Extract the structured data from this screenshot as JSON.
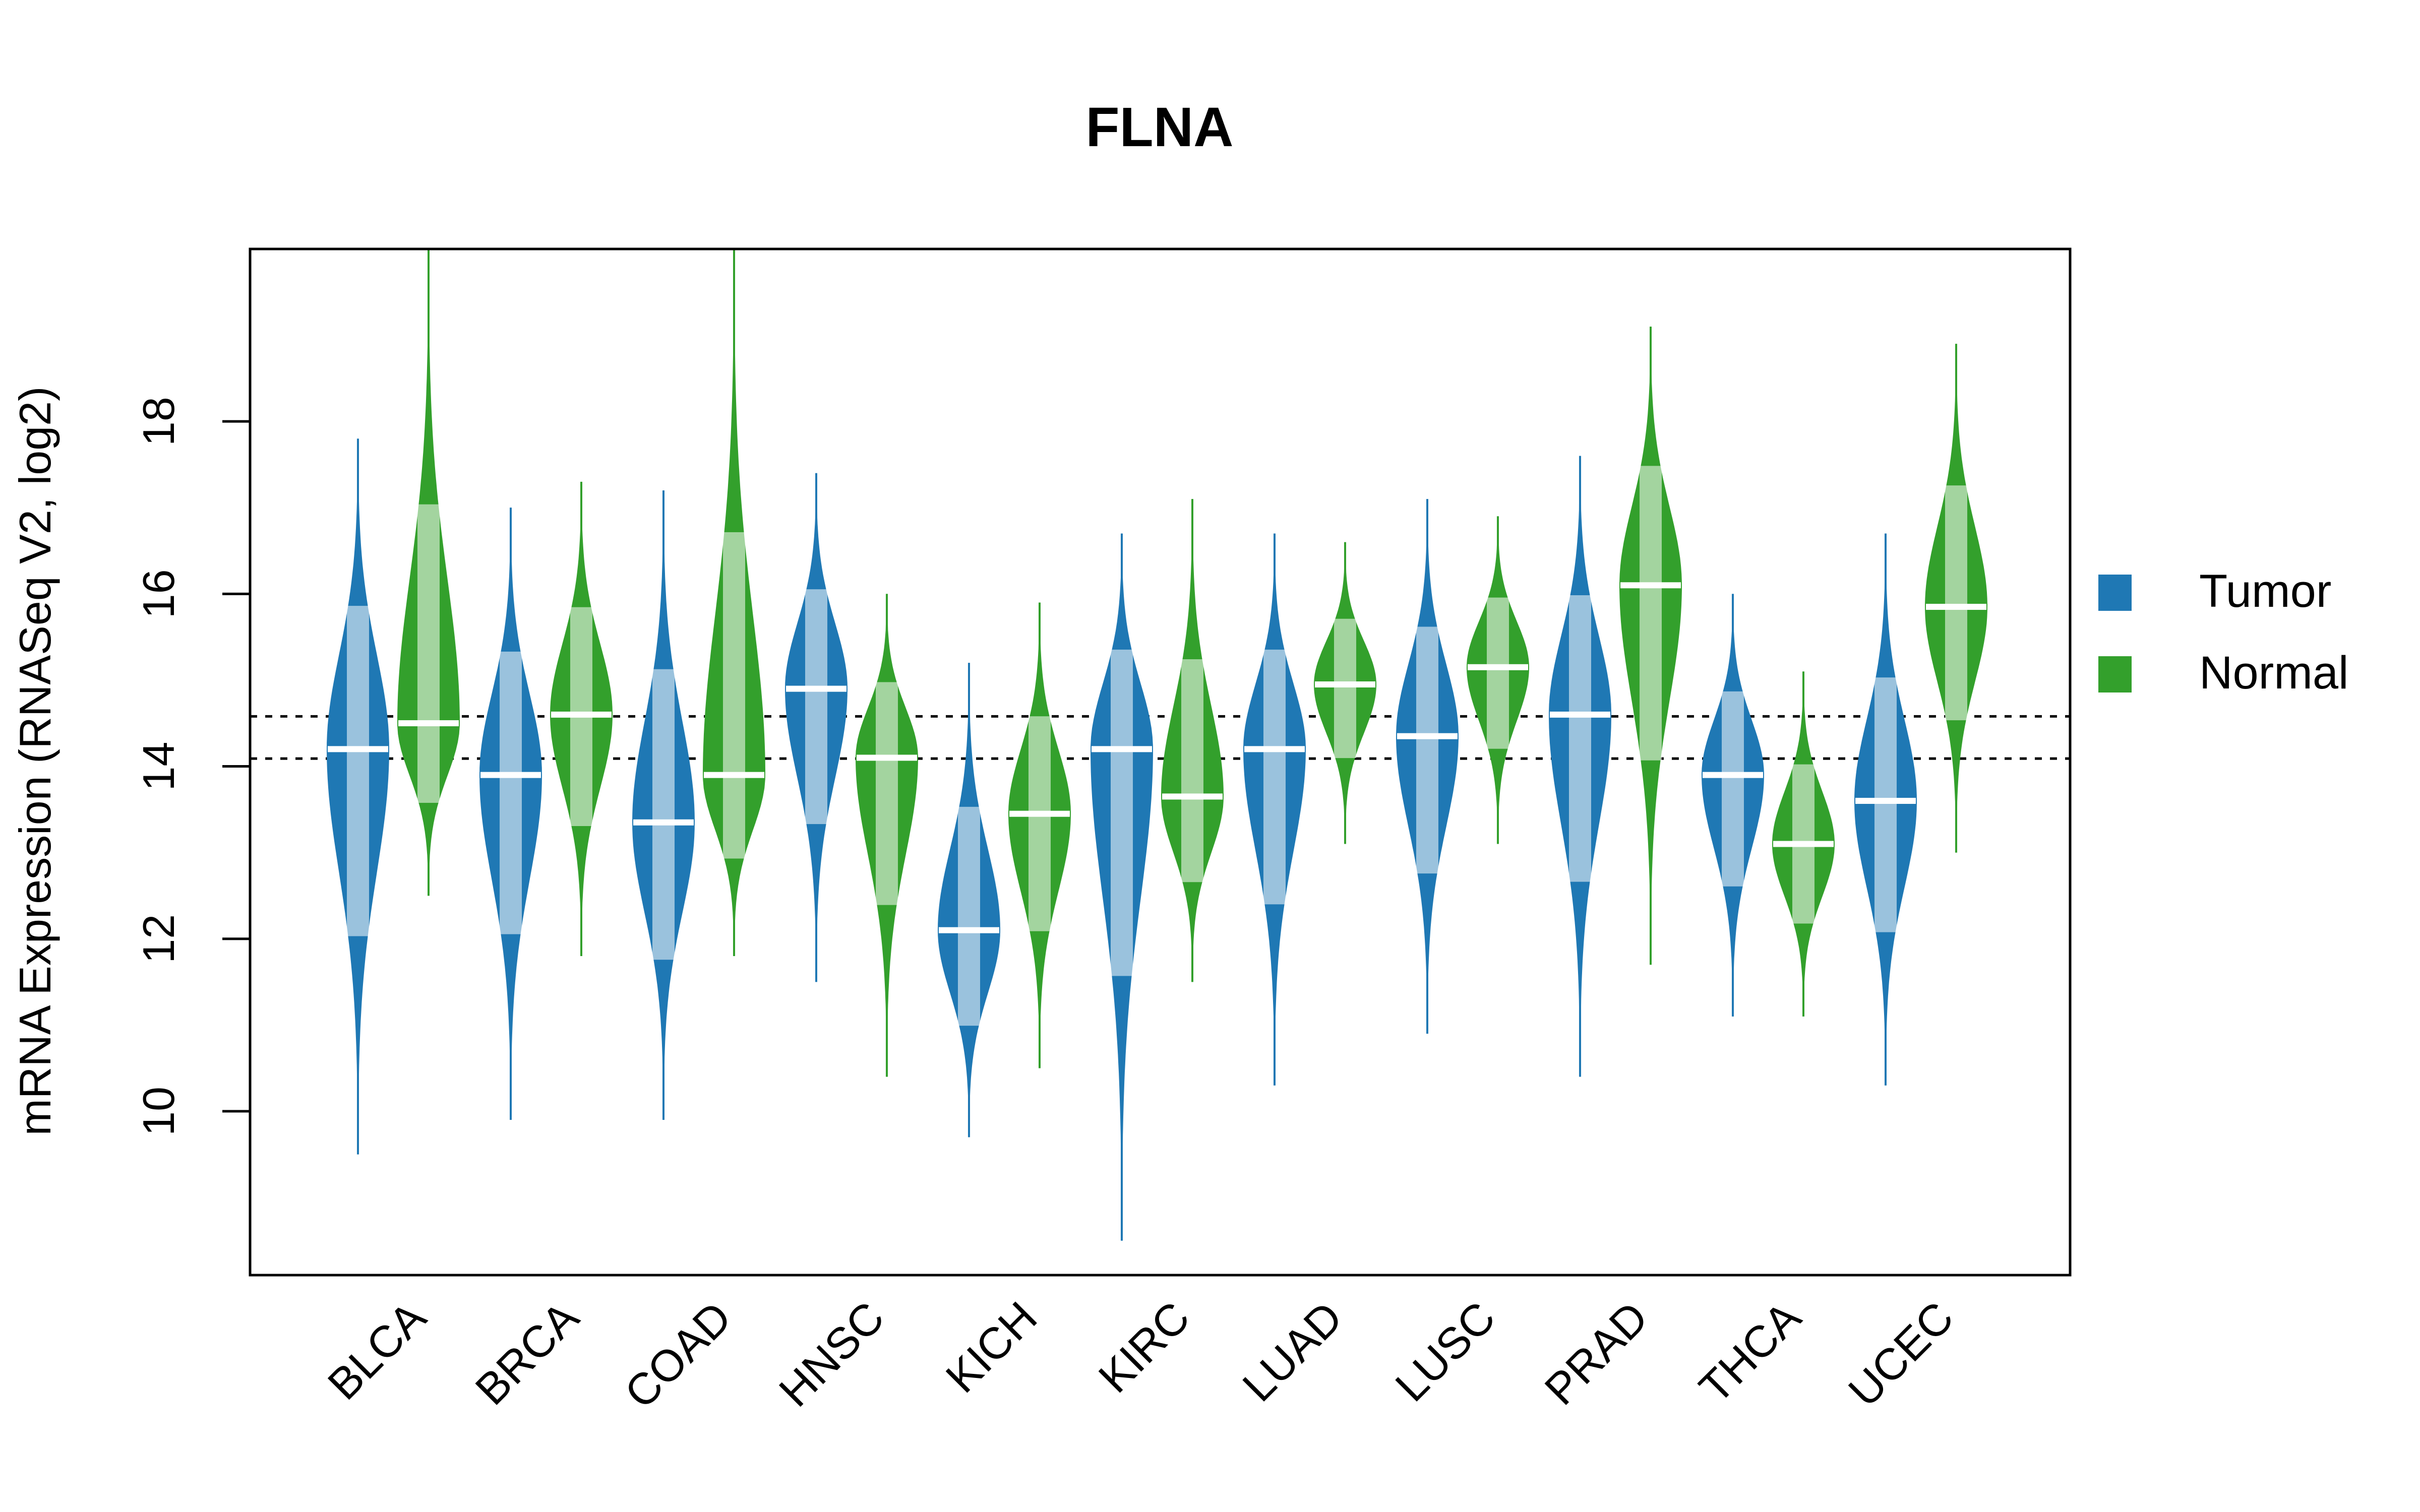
{
  "chart_data": {
    "type": "violin",
    "title": "FLNA",
    "xlabel": "",
    "ylabel": "mRNA Expression (RNASeq V2, log2)",
    "ylim": [
      8.1,
      20.0
    ],
    "yticks": [
      10,
      12,
      14,
      16,
      18
    ],
    "grid": false,
    "reference_lines": [
      14.09,
      14.58
    ],
    "categories": [
      "BLCA",
      "BRCA",
      "COAD",
      "HNSC",
      "KICH",
      "KIRC",
      "LUAD",
      "LUSC",
      "PRAD",
      "THCA",
      "UCEC"
    ],
    "legend": {
      "placement": "right",
      "entries": [
        {
          "label": "Tumor",
          "color": "#1F78B4"
        },
        {
          "label": "Normal",
          "color": "#33A02C"
        }
      ]
    },
    "series": [
      {
        "name": "Tumor",
        "color": "#1F78B4",
        "min": [
          9.5,
          9.9,
          9.9,
          11.5,
          9.7,
          8.5,
          10.3,
          10.9,
          10.4,
          11.1,
          10.3
        ],
        "median": [
          14.2,
          13.9,
          13.35,
          14.9,
          12.1,
          14.2,
          14.2,
          14.35,
          14.6,
          13.9,
          13.6
        ],
        "max": [
          17.8,
          17.0,
          17.2,
          17.4,
          15.2,
          16.7,
          16.7,
          17.1,
          17.6,
          16.0,
          16.7
        ]
      },
      {
        "name": "Normal",
        "color": "#33A02C",
        "min": [
          12.5,
          11.8,
          11.8,
          10.4,
          10.5,
          11.5,
          13.1,
          13.1,
          11.7,
          11.1,
          13.0
        ],
        "median": [
          14.5,
          14.6,
          13.9,
          14.1,
          13.45,
          13.65,
          14.95,
          15.15,
          16.1,
          13.1,
          15.85
        ],
        "max": [
          20.0,
          17.3,
          20.0,
          16.0,
          15.9,
          17.1,
          16.6,
          16.9,
          19.1,
          15.1,
          18.9
        ]
      }
    ]
  }
}
